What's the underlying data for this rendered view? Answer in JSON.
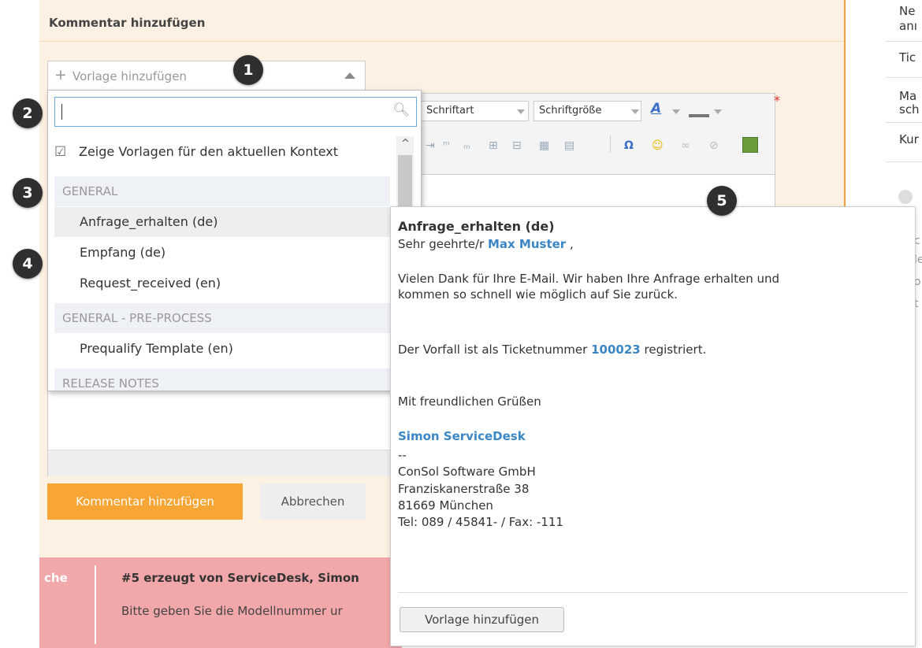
{
  "panel": {
    "title": "Kommentar hinzufügen",
    "template_select": {
      "plus": "+",
      "label": "Vorlage hinzufügen"
    },
    "required_mark": "*"
  },
  "toolbar": {
    "font_select": "Schriftart",
    "size_select": "Schriftgröße",
    "color_letter": "A",
    "icons": [
      "table-icon",
      "omega-icon",
      "smiley-icon",
      "link-icon",
      "unlink-icon",
      "image-icon"
    ]
  },
  "actions": {
    "submit_label": "Kommentar hinzufügen",
    "cancel_label": "Abbrechen"
  },
  "history": {
    "left_text": "che",
    "entry_title": "#5 erzeugt von ServiceDesk, Simon",
    "entry_text": "Bitte geben Sie die Modellnummer ur"
  },
  "sidebar_right": {
    "lines": [
      "Ne",
      "anı",
      "Tic",
      "Ma",
      "sch",
      "Kur"
    ],
    "fragments": [
      "c",
      "le",
      "o",
      "t"
    ]
  },
  "dropdown": {
    "search_value": "",
    "context_checkbox_label": "Zeige Vorlagen für den aktuellen Kontext",
    "groups": [
      {
        "label": "GENERAL",
        "items": [
          "Anfrage_erhalten (de)",
          "Empfang (de)",
          "Request_received (en)"
        ]
      },
      {
        "label": "GENERAL - PRE-PROCESS",
        "items": [
          "Prequalify Template (en)"
        ]
      },
      {
        "label": "RELEASE NOTES",
        "items": []
      }
    ]
  },
  "preview": {
    "title": "Anfrage_erhalten (de)",
    "salutation_prefix": "Sehr geehrte/r",
    "customer_name": "Max Muster",
    "salutation_suffix": ",",
    "body_line1": "Vielen Dank für Ihre E-Mail. Wir haben Ihre Anfrage erhalten und",
    "body_line2": "kommen so schnell wie möglich auf Sie zurück.",
    "ticket_prefix": "Der Vorfall ist als Ticketnummer",
    "ticket_number": "100023",
    "ticket_suffix": "registriert.",
    "closing": "Mit freundlichen Grüßen",
    "agent_name": "Simon ServiceDesk",
    "sig_sep": "--",
    "company": "ConSol Software GmbH",
    "street": "Franziskanerstraße 38",
    "city": "81669 München",
    "phone": "Tel: 089 / 45841- / Fax: -111",
    "add_button": "Vorlage hinzufügen"
  },
  "badges": [
    "1",
    "2",
    "3",
    "4",
    "5"
  ],
  "colors": {
    "accent_orange": "#f7a535",
    "panel_bg": "#fdf1e3",
    "link_blue": "#3b86c4",
    "alert_pink": "#f2a7aa",
    "badge_dark": "#2f2f2f"
  }
}
